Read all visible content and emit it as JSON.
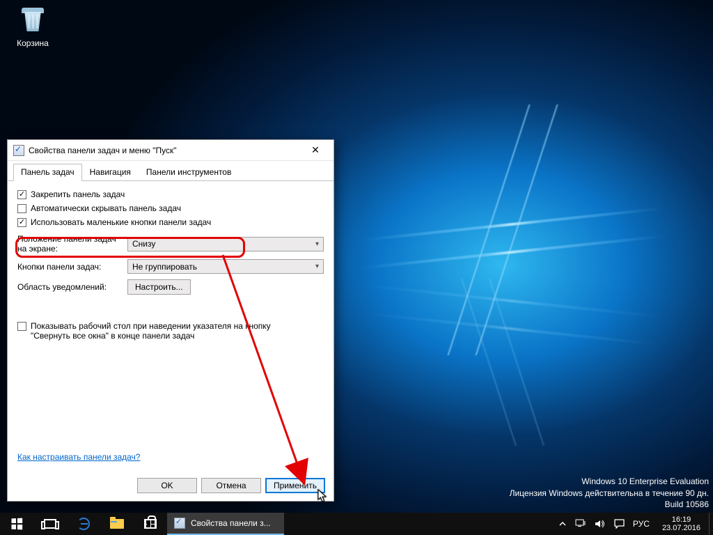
{
  "desktop": {
    "recycle_bin_label": "Корзина"
  },
  "watermark": {
    "line1": "Windows 10 Enterprise Evaluation",
    "line2": "Лицензия Windows действительна в течение 90 дн.",
    "line3": "Build 10586"
  },
  "dialog": {
    "title": "Свойства панели задач и меню \"Пуск\"",
    "tabs": {
      "taskbar": "Панель задач",
      "navigation": "Навигация",
      "toolbars": "Панели инструментов"
    },
    "checkboxes": {
      "lock": "Закрепить панель задач",
      "autohide": "Автоматически скрывать панель задач",
      "small_buttons": "Использовать маленькие кнопки панели задач",
      "peek": "Показывать рабочий стол при наведении указателя на кнопку \"Свернуть все окна\" в конце панели задач"
    },
    "labels": {
      "position": "Положение панели задач на экране:",
      "buttons": "Кнопки панели задач:",
      "notification": "Область уведомлений:"
    },
    "values": {
      "position": "Снизу",
      "buttons": "Не группировать",
      "customize": "Настроить..."
    },
    "help_link": "Как настраивать панели задач?",
    "buttons_footer": {
      "ok": "OK",
      "cancel": "Отмена",
      "apply": "Применить"
    }
  },
  "taskbar": {
    "active_app": "Свойства панели з...",
    "lang": "РУС",
    "time": "16:19",
    "date": "23.07.2016"
  }
}
